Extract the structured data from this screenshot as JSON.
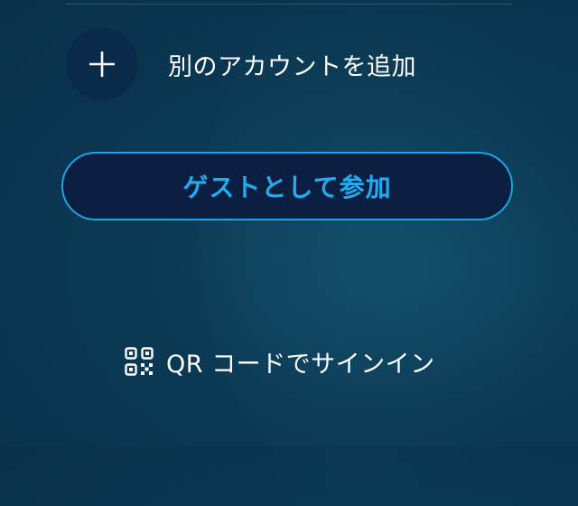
{
  "add_account": {
    "icon": "plus-icon",
    "label": "別のアカウントを追加"
  },
  "guest_button": {
    "label": "ゲストとして参加"
  },
  "qr_signin": {
    "icon": "qr-code-icon",
    "label": "QR コードでサインイン"
  },
  "colors": {
    "background": "#0b3a55",
    "circle": "#0a2a4c",
    "button_fill": "#0b1f43",
    "accent": "#1aa6e6",
    "text": "#ffffff"
  }
}
